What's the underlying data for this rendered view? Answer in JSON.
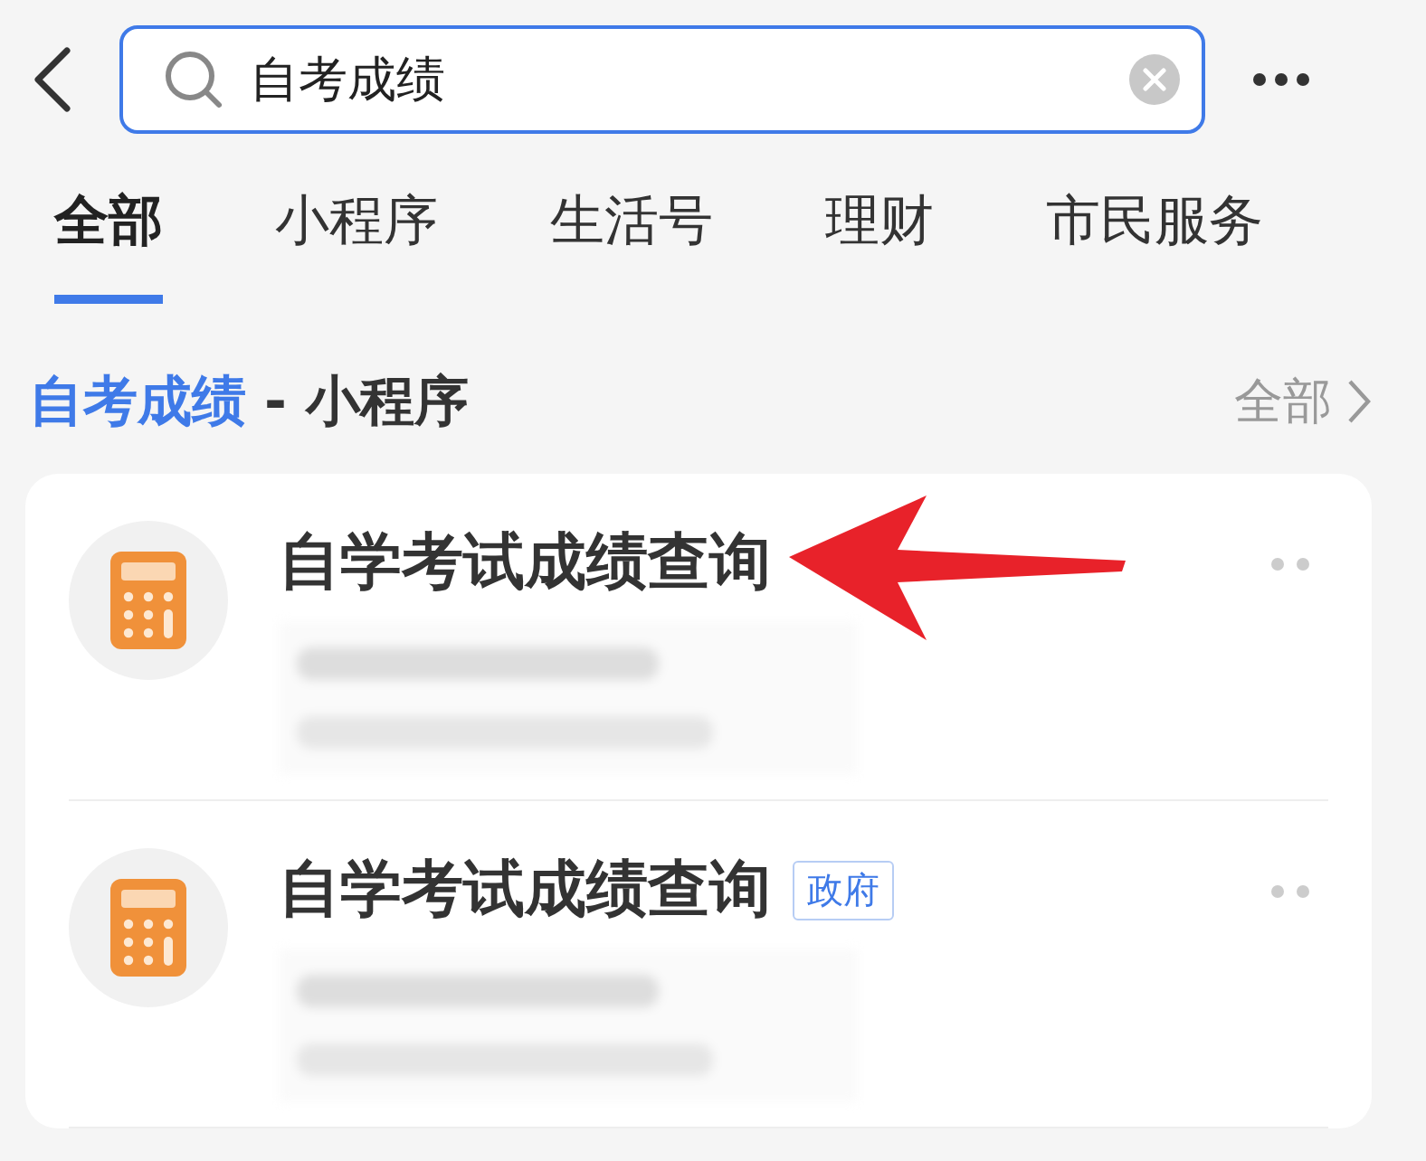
{
  "search": {
    "value": "自考成绩"
  },
  "tabs": [
    {
      "label": "全部",
      "selected": true
    },
    {
      "label": "小程序",
      "selected": false
    },
    {
      "label": "生活号",
      "selected": false
    },
    {
      "label": "理财",
      "selected": false
    },
    {
      "label": "市民服务",
      "selected": false
    }
  ],
  "section": {
    "keyword": "自考成绩",
    "suffix": "- 小程序",
    "more": "全部"
  },
  "results": [
    {
      "title": "自学考试成绩查询",
      "annotated": true
    },
    {
      "title": "自学考试成绩查询",
      "tag": "政府",
      "annotated": false
    }
  ]
}
